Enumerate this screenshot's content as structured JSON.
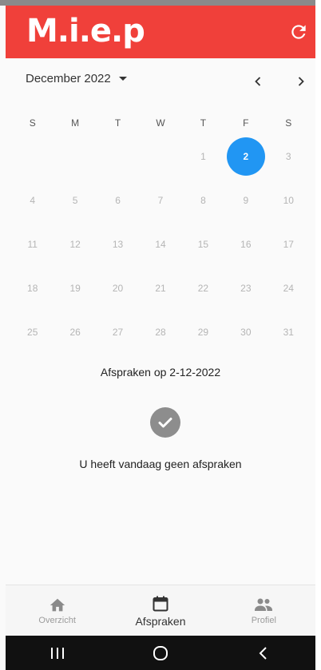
{
  "app": {
    "logo_text": "M.i.e.p"
  },
  "calendar": {
    "month_label": "December 2022",
    "weekdays": [
      "S",
      "M",
      "T",
      "W",
      "T",
      "F",
      "S"
    ],
    "selected_day": "2",
    "weeks": [
      [
        "",
        "",
        "",
        "",
        "1",
        "2",
        "3"
      ],
      [
        "4",
        "5",
        "6",
        "7",
        "8",
        "9",
        "10"
      ],
      [
        "11",
        "12",
        "13",
        "14",
        "15",
        "16",
        "17"
      ],
      [
        "18",
        "19",
        "20",
        "21",
        "22",
        "23",
        "24"
      ],
      [
        "25",
        "26",
        "27",
        "28",
        "29",
        "30",
        "31"
      ]
    ]
  },
  "appointments": {
    "title": "Afspraken op 2-12-2022",
    "empty_message": "U heeft vandaag geen afspraken"
  },
  "bottom_nav": {
    "items": [
      {
        "label": "Overzicht",
        "icon": "home-icon"
      },
      {
        "label": "Afspraken",
        "icon": "calendar-icon"
      },
      {
        "label": "Profiel",
        "icon": "people-icon"
      }
    ],
    "active_index": 1
  },
  "colors": {
    "appbar": "#f0403a",
    "selected_day": "#2196f3"
  }
}
